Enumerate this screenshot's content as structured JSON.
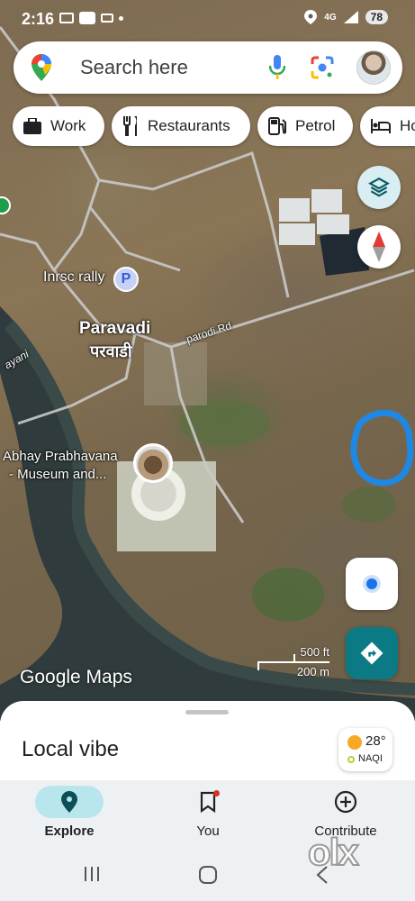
{
  "status_bar": {
    "time": "2:16",
    "network": "4G",
    "battery": "78",
    "icons": [
      "screenshot-icon",
      "app-icon",
      "cast-icon",
      "dot-icon",
      "location-icon",
      "signal-icon"
    ]
  },
  "search": {
    "placeholder": "Search here",
    "icons": [
      "maps-pin-icon",
      "mic-icon",
      "lens-icon",
      "avatar"
    ]
  },
  "chips": [
    {
      "label": "Work",
      "icon": "briefcase-icon"
    },
    {
      "label": "Restaurants",
      "icon": "fork-knife-icon"
    },
    {
      "label": "Petrol",
      "icon": "fuel-icon"
    },
    {
      "label": "Ho",
      "icon": "bed-icon"
    }
  ],
  "map": {
    "labels": {
      "inrsc": "Inrsc rally",
      "paravadi_en": "Paravadi",
      "paravadi_mr": "परवाडी",
      "road": "parodi Rd",
      "river": "ayani",
      "museum_line1": "Abhay Prabhavana",
      "museum_line2": "- Museum and..."
    },
    "poi_parking": "P",
    "logo": "Google Maps",
    "scale_ft": "500 ft",
    "scale_m": "200 m",
    "highlight_color": "#1e88e5"
  },
  "sheet": {
    "title": "Local vibe",
    "weather_temp": "28°",
    "air_quality": "NAQI"
  },
  "nav": [
    {
      "label": "Explore",
      "icon": "explore-pin-icon",
      "active": true
    },
    {
      "label": "You",
      "icon": "bookmark-icon",
      "active": false
    },
    {
      "label": "Contribute",
      "icon": "add-circle-icon",
      "active": false
    }
  ],
  "watermark": "olx",
  "colors": {
    "accent": "#0b7a84",
    "active_tab": "#b9e6ec",
    "location_dot": "#1a73e8"
  }
}
